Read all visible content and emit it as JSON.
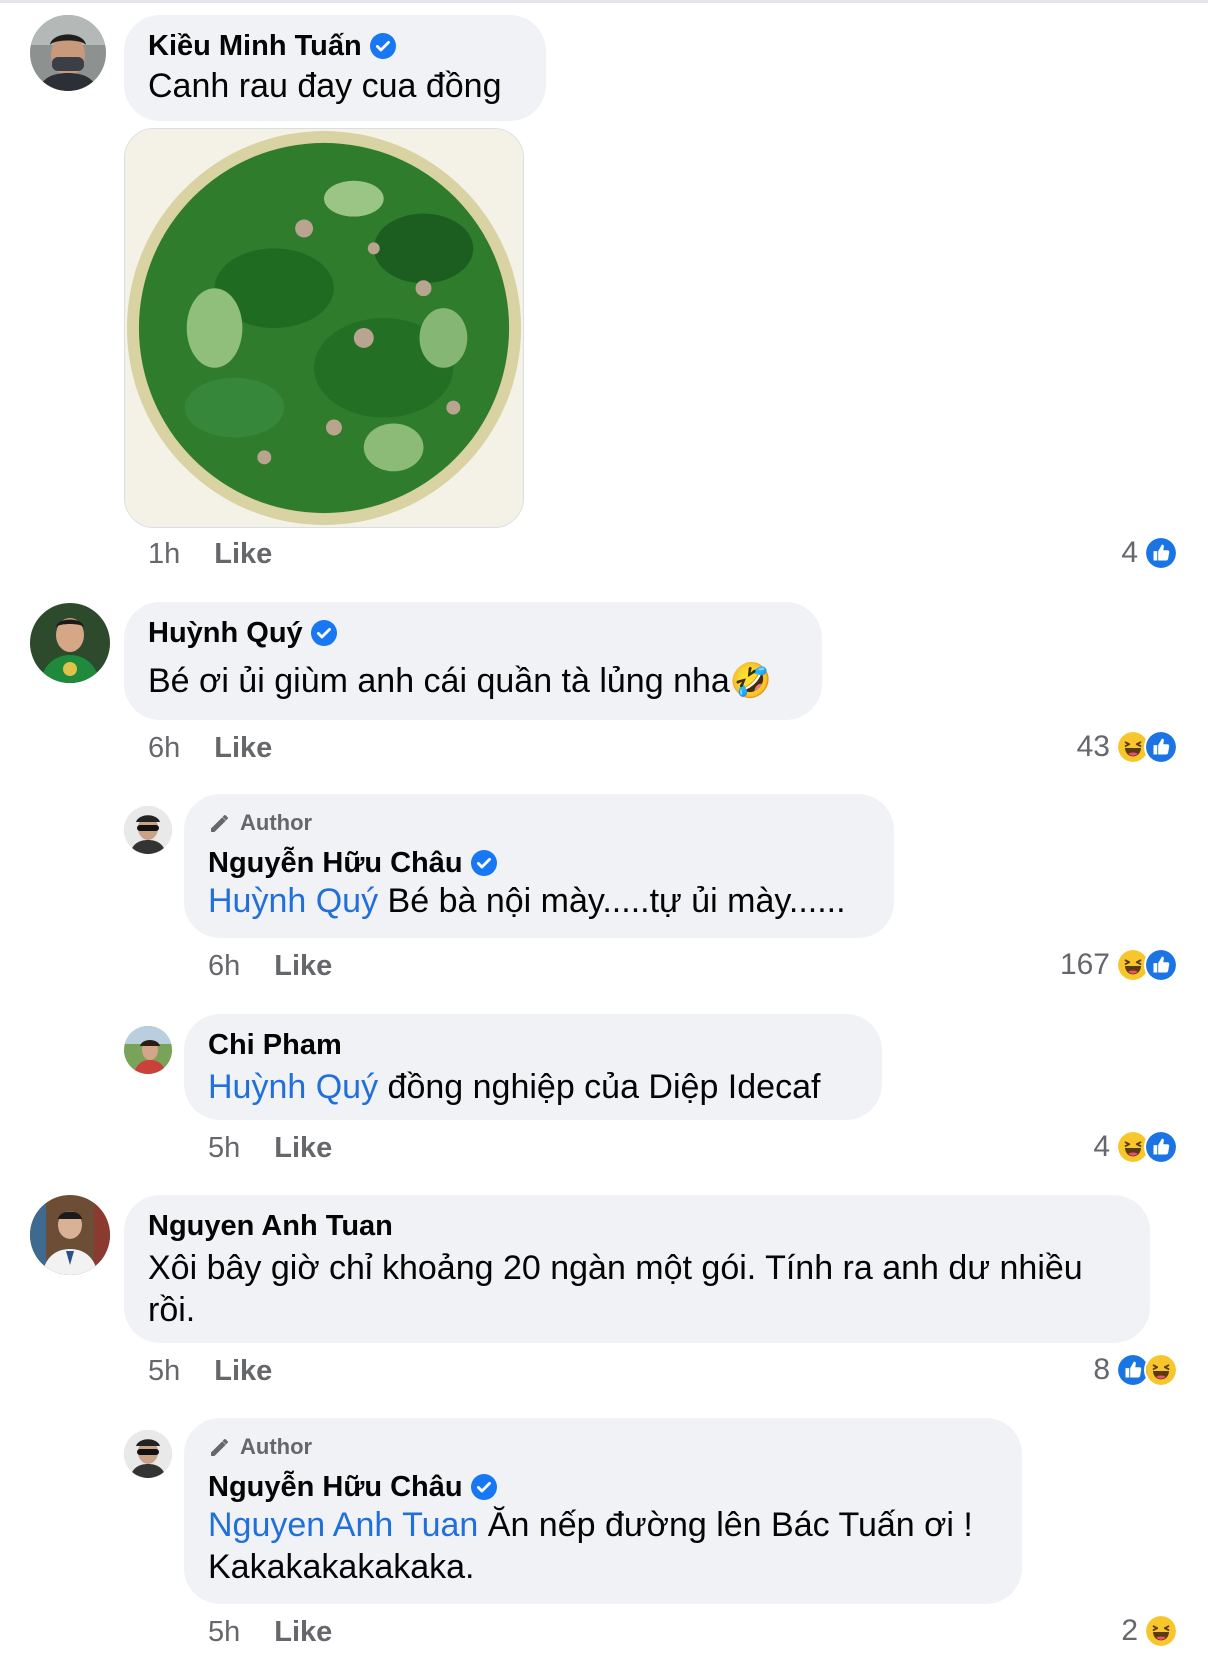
{
  "comments": [
    {
      "name": "Kiều Minh Tuấn",
      "verified": true,
      "text": "Canh rau đay cua đồng",
      "time": "1h",
      "like_label": "Like",
      "reaction_count": "4",
      "reactions": [
        "like-icon"
      ]
    },
    {
      "name": "Huỳnh Quý",
      "verified": true,
      "text": "Bé ơi ủi giùm anh cái quần tà lủng nha🤣",
      "time": "6h",
      "like_label": "Like",
      "reaction_count": "43",
      "reactions": [
        "haha-icon",
        "like-icon"
      ]
    },
    {
      "author_label": "Author",
      "name": "Nguyễn Hữu Châu",
      "verified": true,
      "mention": "Huỳnh Quý",
      "text": " Bé bà nội mày.....tự ủi mày......",
      "time": "6h",
      "like_label": "Like",
      "reaction_count": "167",
      "reactions": [
        "haha-icon",
        "like-icon"
      ]
    },
    {
      "name": "Chi Pham",
      "verified": false,
      "mention": "Huỳnh Quý",
      "text": " đồng nghiệp của Diệp Idecaf",
      "time": "5h",
      "like_label": "Like",
      "reaction_count": "4",
      "reactions": [
        "haha-icon",
        "like-icon"
      ]
    },
    {
      "name": "Nguyen Anh Tuan",
      "verified": false,
      "text": "Xôi bây giờ chỉ khoảng 20 ngàn một gói. Tính ra anh dư nhiều rồi.",
      "time": "5h",
      "like_label": "Like",
      "reaction_count": "8",
      "reactions": [
        "like-icon",
        "haha-icon"
      ]
    },
    {
      "author_label": "Author",
      "name": "Nguyễn Hữu Châu",
      "verified": true,
      "mention": "Nguyen Anh Tuan",
      "text": " Ăn nếp đường lên Bác Tuấn ơi ! Kakakakakakaka.",
      "time": "5h",
      "like_label": "Like",
      "reaction_count": "2",
      "reactions": [
        "haha-icon"
      ]
    }
  ],
  "colors": {
    "bubble": "#f0f2f5",
    "mention": "#216fdb",
    "meta": "#65676b",
    "verified": "#1877f2"
  }
}
